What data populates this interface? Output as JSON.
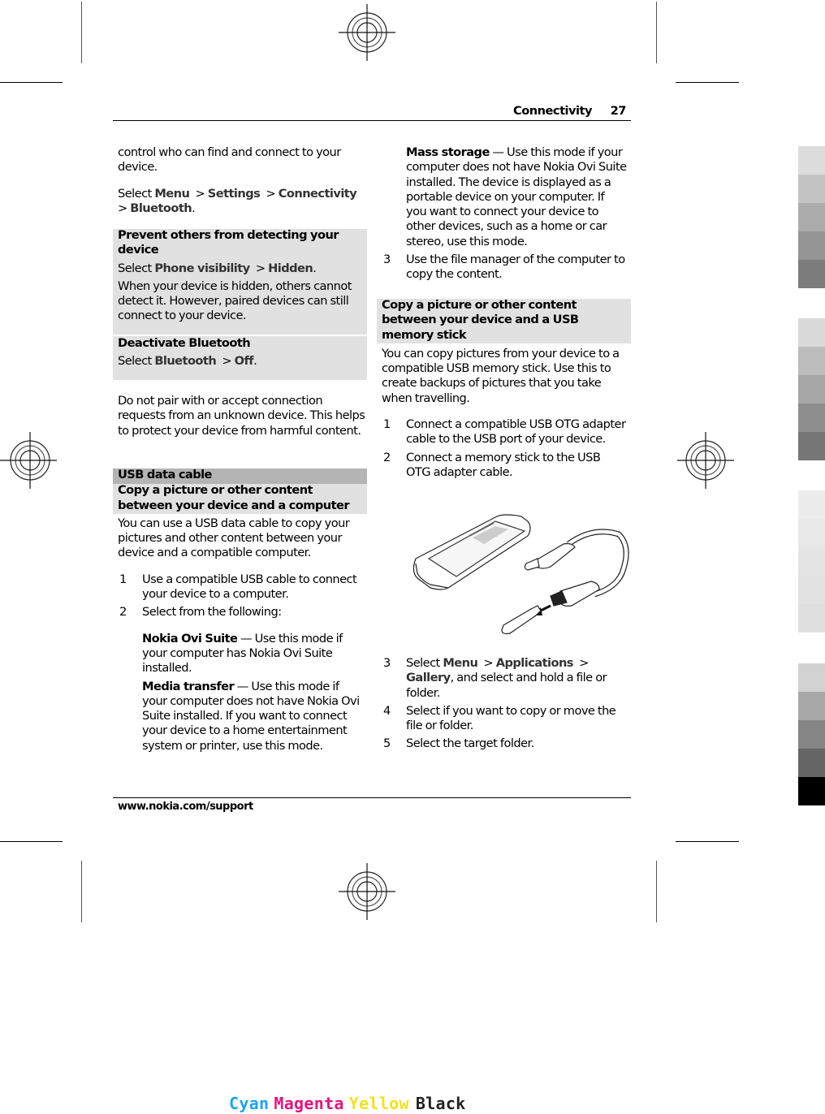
{
  "header": {
    "section": "Connectivity",
    "page_number": "27"
  },
  "footer": {
    "url": "www.nokia.com/support"
  },
  "left_column": {
    "intro": "control who can find and connect to your device.",
    "select_path": {
      "prefix": "Select ",
      "items": [
        "Menu",
        "Settings",
        "Connectivity",
        "Bluetooth"
      ],
      "sep": " > ",
      "suffix": "."
    },
    "box_hide": {
      "title": "Prevent others from detecting your device",
      "select_prefix": "Select ",
      "select_items": [
        "Phone visibility",
        "Hidden"
      ],
      "body": "When your device is hidden, others cannot detect it. However, paired devices can still connect to your device."
    },
    "box_deactivate": {
      "title": "Deactivate Bluetooth",
      "select_prefix": "Select ",
      "select_items": [
        "Bluetooth",
        "Off"
      ]
    },
    "warning": "Do not pair with or accept connection requests from an unknown device. This helps to protect your device from harmful content.",
    "usb_section": {
      "title": "USB data cable",
      "subtitle": "Copy a picture or other content between your device and a computer",
      "intro": "You can use a USB data cable to copy your pictures and other content between your device and a compatible computer.",
      "steps": [
        {
          "num": "1",
          "text": "Use a compatible USB cable to connect your device to a computer."
        },
        {
          "num": "2",
          "text": "Select from the following:"
        }
      ],
      "modes": [
        {
          "name": "Nokia Ovi Suite",
          "desc": " — Use this mode if your computer has Nokia Ovi Suite installed."
        },
        {
          "name": "Media transfer",
          "desc": " — Use this mode if your computer does not have Nokia Ovi Suite installed. If you want to connect your device to a home entertainment system or printer, use this mode."
        }
      ]
    }
  },
  "right_column": {
    "mode_mass_storage": {
      "name": "Mass storage",
      "desc": " — Use this mode if your computer does not have Nokia Ovi Suite installed. The device is displayed as a portable device on your computer. If you want to connect your device to other devices, such as a home or car stereo, use this mode."
    },
    "step3": {
      "num": "3",
      "text": "Use the file manager of the computer to copy the content."
    },
    "memory_stick_section": {
      "title": "Copy a picture or other content between your device and a USB memory stick",
      "intro": "You can copy pictures from your device to a compatible USB memory stick. Use this to create backups of pictures that you take when travelling.",
      "steps_a": [
        {
          "num": "1",
          "text": "Connect a compatible USB OTG adapter cable to the USB port of your device."
        },
        {
          "num": "2",
          "text": "Connect a memory stick to the USB OTG adapter cable."
        }
      ],
      "illustration": "phone-usb-otg-cable-memory-stick",
      "step3": {
        "num": "3",
        "prefix": "Select ",
        "items": [
          "Menu",
          "Applications",
          "Gallery"
        ],
        "suffix": ", and select and hold a file or folder."
      },
      "steps_b": [
        {
          "num": "4",
          "text": "Select if you want to copy or move the file or folder."
        },
        {
          "num": "5",
          "text": "Select the target folder."
        }
      ]
    }
  },
  "print_marks": {
    "cmyk_labels": [
      {
        "label": "Cyan",
        "color": "#1aa7e8"
      },
      {
        "label": "Magenta",
        "color": "#e3157f"
      },
      {
        "label": "Yellow",
        "color": "#f2e21b"
      },
      {
        "label": "Black",
        "color": "#222222"
      }
    ],
    "swatch_groups": [
      [
        "#dcdcdc",
        "#c4c4c4",
        "#acacac",
        "#949494",
        "#7c7c7c"
      ],
      [
        "#dadada",
        "#bcbcbc",
        "#a6a6a6",
        "#8e8e8e",
        "#767676"
      ],
      [
        "#ececec",
        "#e8e8e8",
        "#e5e5e5",
        "#e2e2e2",
        "#dfdfdf"
      ],
      [
        "#d2d2d2",
        "#a8a8a8",
        "#858585",
        "#656565",
        "#000000"
      ]
    ]
  }
}
